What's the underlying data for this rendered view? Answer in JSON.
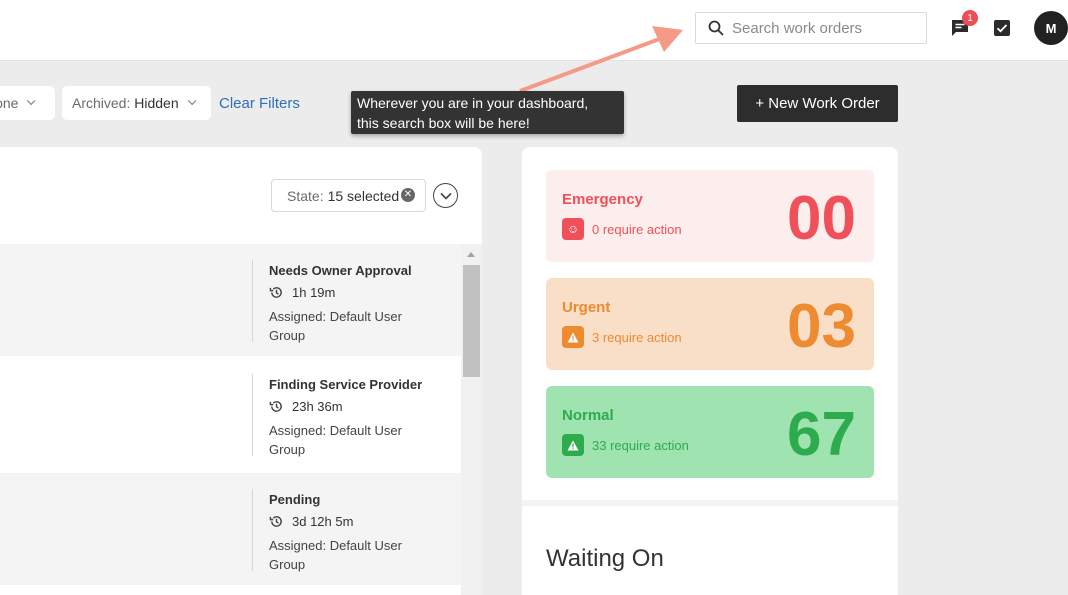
{
  "header": {
    "search_placeholder": "Search work orders",
    "notification_count": "1",
    "avatar_initial": "M"
  },
  "filters": {
    "first_partial_label": "None",
    "archived_label": "Archived:",
    "archived_value": "Hidden",
    "clear_label": "Clear Filters",
    "new_work_order_label": "+ New Work Order"
  },
  "tooltip": {
    "line1": "Wherever you are in your dashboard,",
    "line2": "this search box will be here!"
  },
  "work_orders": {
    "state_filter_label": "State:",
    "state_filter_value": "15 selected",
    "rows": [
      {
        "status": "Needs Owner Approval",
        "time": "1h 19m",
        "assigned": "Assigned: Default User Group"
      },
      {
        "status": "Finding Service Provider",
        "time": "23h 36m",
        "assigned": "Assigned: Default User Group"
      },
      {
        "status": "Pending",
        "time": "3d 12h 5m",
        "assigned": "Assigned: Default User Group"
      }
    ]
  },
  "priority": {
    "emergency": {
      "label": "Emergency",
      "action": "0 require action",
      "count": "00",
      "color": "#f0505a",
      "bg": "#fdeeee"
    },
    "urgent": {
      "label": "Urgent",
      "action": "3 require action",
      "count": "03",
      "color": "#ee8a30",
      "bg": "#fadfc8"
    },
    "normal": {
      "label": "Normal",
      "action": "33 require action",
      "count": "67",
      "color": "#2eab4d",
      "bg": "#9fe3b0"
    }
  },
  "waiting_on": {
    "title": "Waiting On"
  }
}
